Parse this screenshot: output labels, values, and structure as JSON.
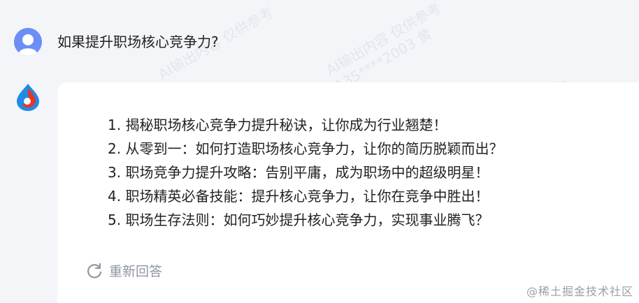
{
  "conversation": {
    "question": "如果提升职场核心竞争力?",
    "answers": [
      "1. 揭秘职场核心竞争力提升秘诀，让你成为行业翘楚！",
      "2. 从零到一：如何打造职场核心竞争力，让你的简历脱颖而出？",
      "3. 职场竞争力提升攻略：告别平庸，成为职场中的超级明星！",
      "4. 职场精英必备技能：提升核心竞争力，让你在竞争中胜出！",
      "5. 职场生存法则：如何巧妙提升核心竞争力，实现事业腾飞？"
    ],
    "regenerate_label": "重新回答"
  },
  "watermark": {
    "line1": "AI输出内容 仅供参考",
    "line2": "135****2003 黄"
  },
  "site_mark": "@稀土掘金技术社区",
  "colors": {
    "background": "#f4f5f9",
    "card": "#ffffff",
    "user_avatar": "#6d8ef5",
    "bot_red": "#e5362b",
    "bot_blue": "#1e8be8",
    "muted_text": "#8f95a3"
  },
  "icons": {
    "user_avatar": "user-avatar-icon",
    "bot_avatar": "bot-logo-icon",
    "regenerate": "refresh-icon"
  }
}
